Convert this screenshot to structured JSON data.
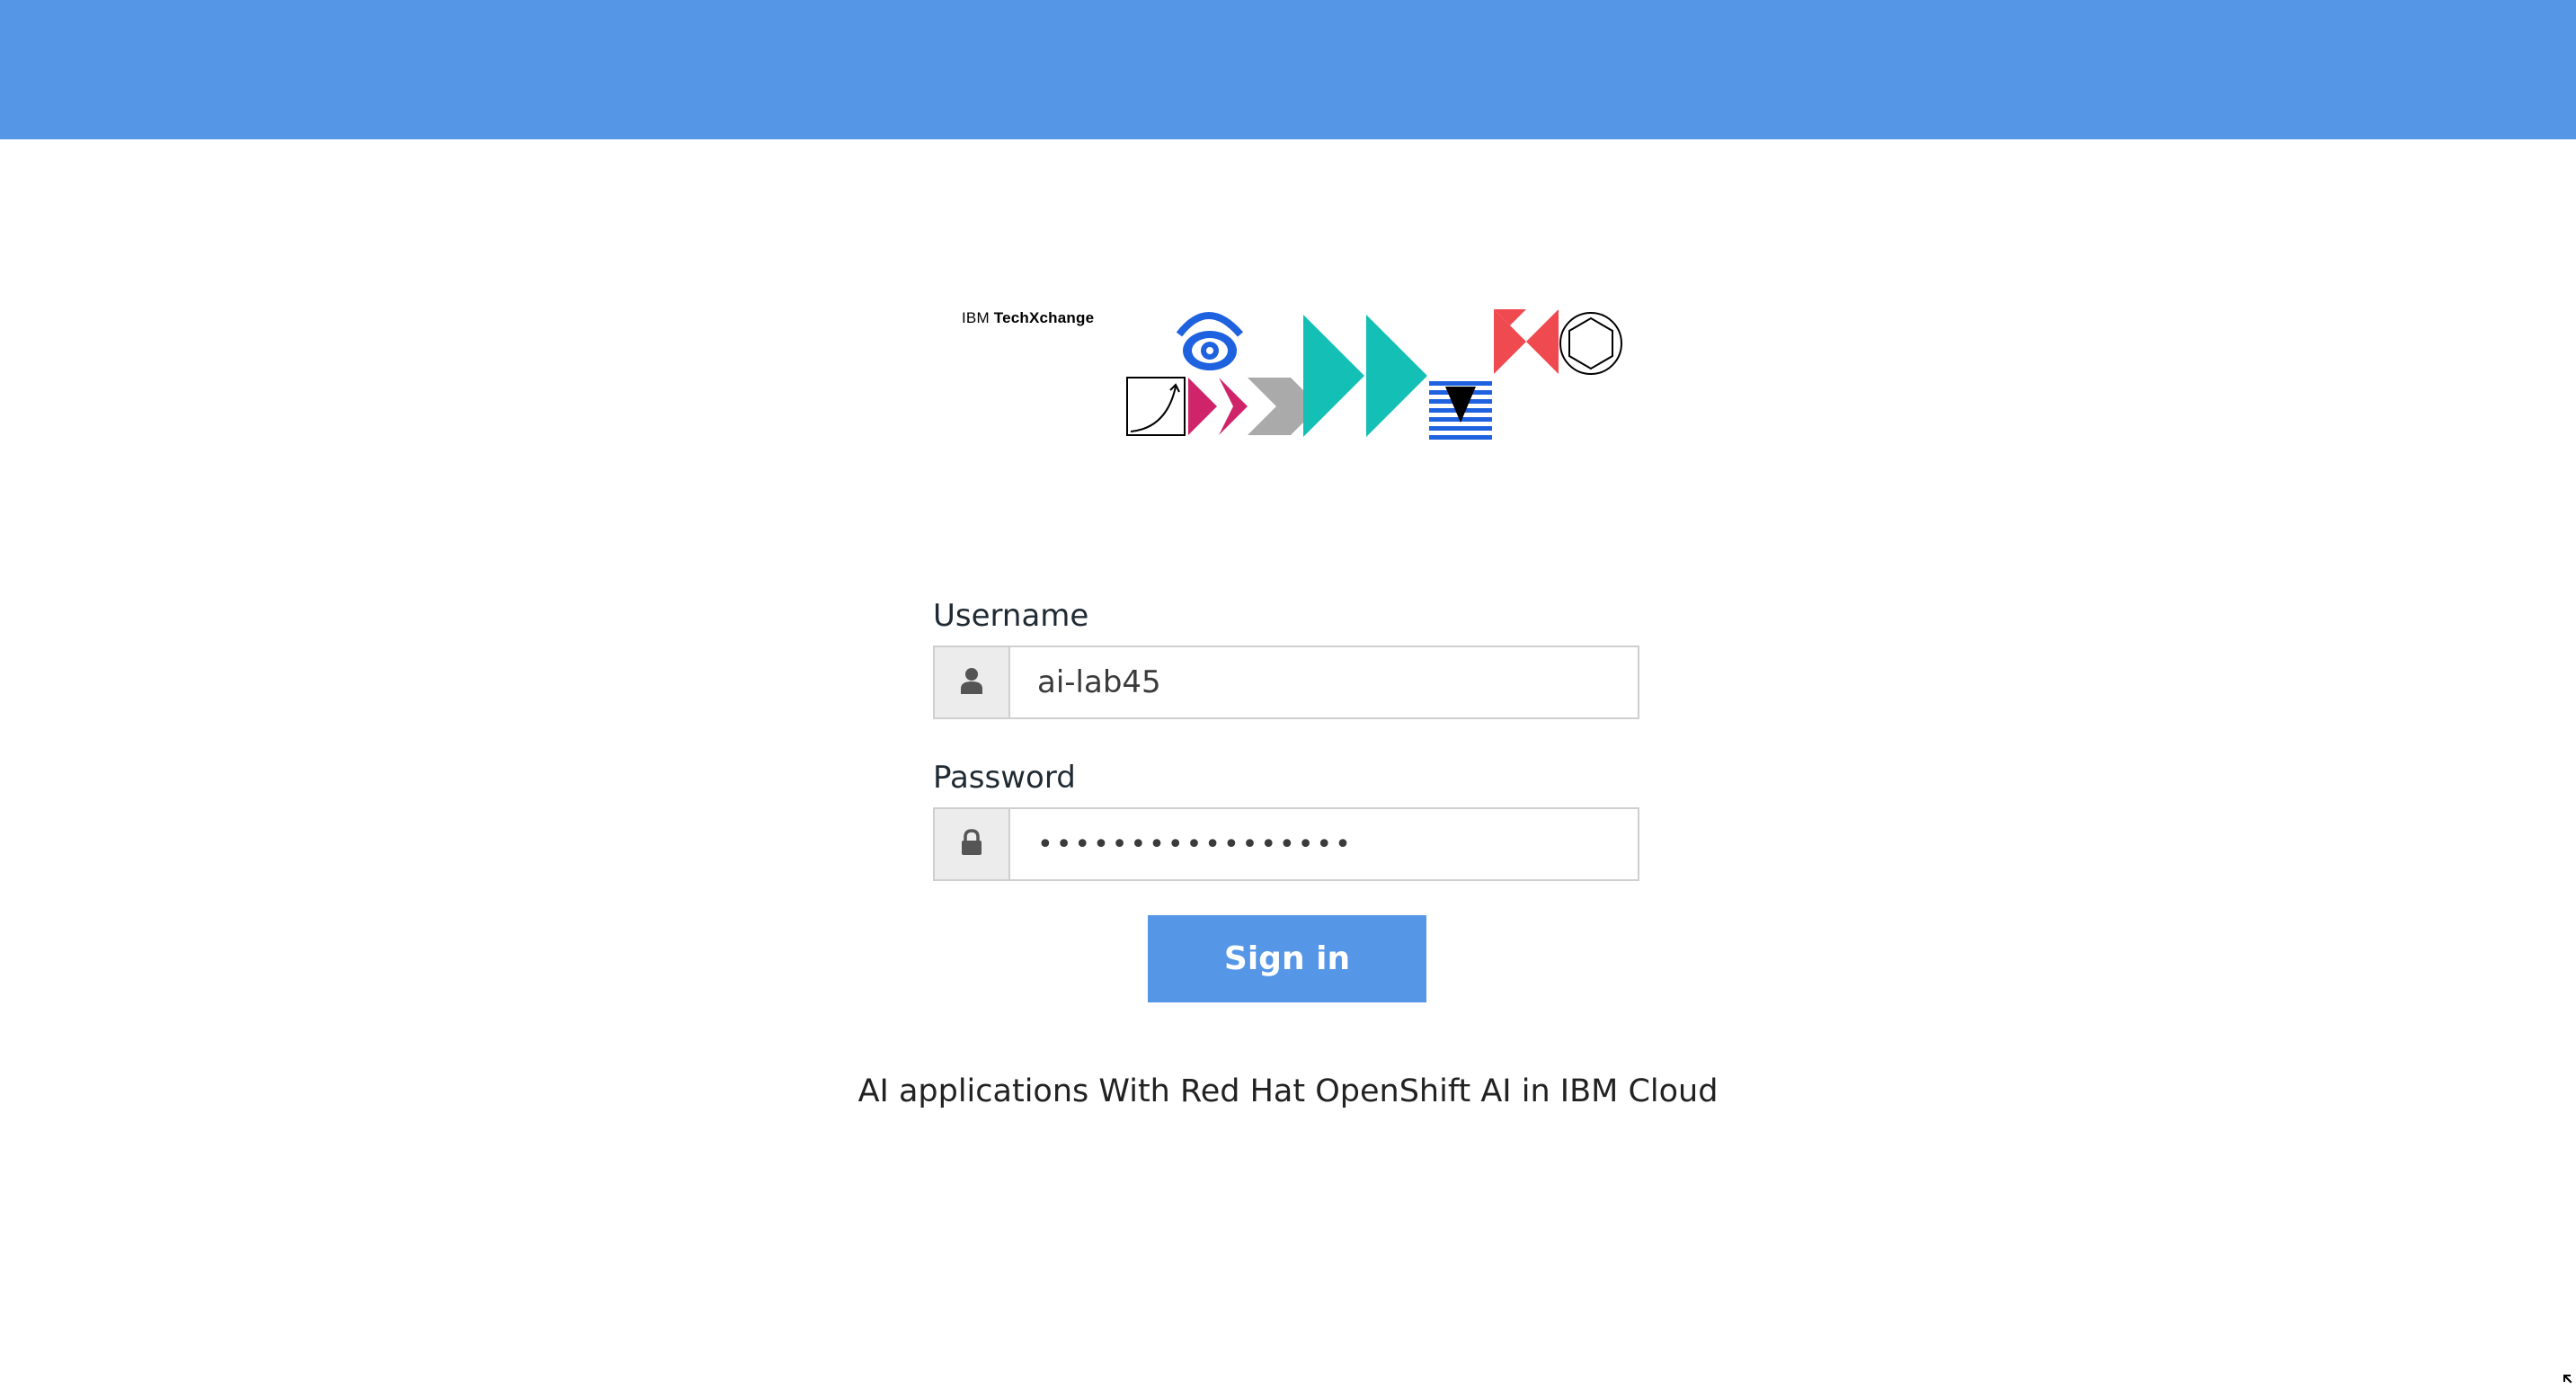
{
  "header": {
    "color": "#5596e6"
  },
  "logo": {
    "brand": "IBM",
    "event": "TechXchange"
  },
  "form": {
    "username_label": "Username",
    "username_value": "ai-lab45",
    "password_label": "Password",
    "password_value": "•••••••••••••••••",
    "submit_label": "Sign in",
    "icons": {
      "username": "user-icon",
      "password": "lock-icon"
    }
  },
  "caption": "AI applications With Red Hat OpenShift AI in IBM Cloud",
  "colors": {
    "accent": "#5596e6",
    "pink": "#d0246a",
    "teal": "#14bfb5",
    "blue": "#1f62e0",
    "red": "#ee4a50",
    "gray": "#aaaaaa"
  }
}
